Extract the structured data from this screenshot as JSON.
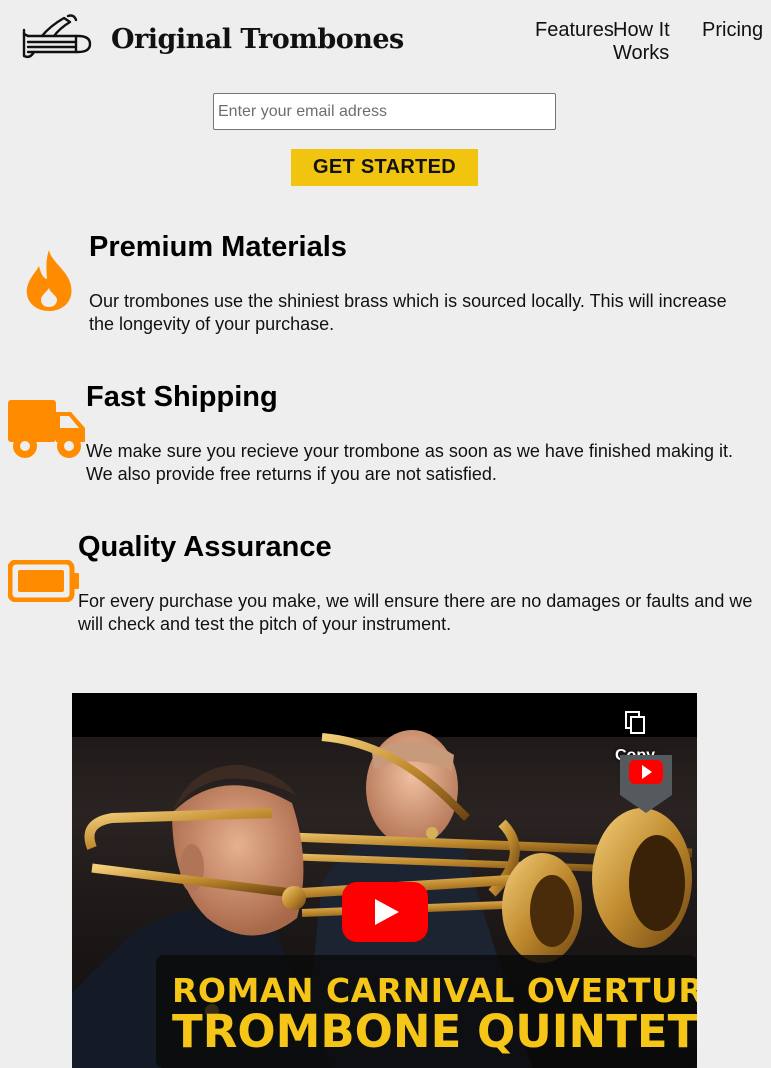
{
  "header": {
    "logo_icon": "trombone-icon",
    "logo_text": "Original Trombones",
    "nav": [
      "Features",
      "How It Works",
      "Pricing"
    ]
  },
  "signup": {
    "email_placeholder": "Enter your email adress",
    "email_value": "",
    "button_label": "GET STARTED",
    "button_color": "#f1c40f"
  },
  "features": [
    {
      "icon": "fire-icon",
      "title": "Premium Materials",
      "description": "Our trombones use the shiniest brass which is sourced locally. This will increase the longevity of your purchase."
    },
    {
      "icon": "truck-icon",
      "title": "Fast Shipping",
      "description": "We make sure you recieve your trombone as soon as we have finished making it. We also provide free returns if you are not satisfied."
    },
    {
      "icon": "battery-full-icon",
      "title": "Quality Assurance",
      "description": "For every purchase you make, we will ensure there are no damages or faults and we will check and test the pitch of your instrument."
    }
  ],
  "video": {
    "copy_link_label": "Copy link",
    "caption_line1": "ROMAN CARNIVAL OVERTURE",
    "caption_line2": "TROMBONE QUINTET"
  },
  "colors": {
    "accent_orange": "#ff8c00",
    "cta_yellow": "#f1c40f",
    "youtube_red": "#ff0000",
    "caption_yellow": "#f5c518",
    "background": "#eeeeee"
  }
}
